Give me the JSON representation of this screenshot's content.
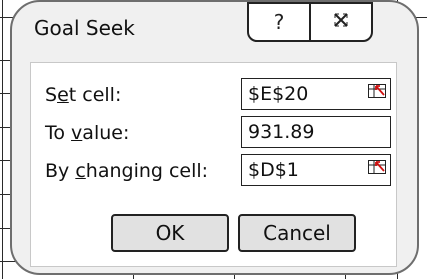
{
  "dialog": {
    "title": "Goal Seek",
    "help_glyph": "?",
    "close_glyph": "⨯"
  },
  "fields": {
    "set_cell": {
      "label_pre": "S",
      "label_ul": "e",
      "label_post": "t cell:",
      "value": "$E$20"
    },
    "to_value": {
      "label_pre": "To ",
      "label_ul": "v",
      "label_post": "alue:",
      "value": "931.89"
    },
    "changing_cell": {
      "label_pre": "By ",
      "label_ul": "c",
      "label_post": "hanging cell:",
      "value": "$D$1"
    }
  },
  "buttons": {
    "ok": "OK",
    "cancel": "Cancel"
  },
  "icons": {
    "help": "question-icon",
    "close": "close-icon",
    "range_selector": "range-selector-icon"
  },
  "colors": {
    "dialog_bg": "#f0f0f0",
    "border": "#222222",
    "accent_red": "#d01010"
  }
}
